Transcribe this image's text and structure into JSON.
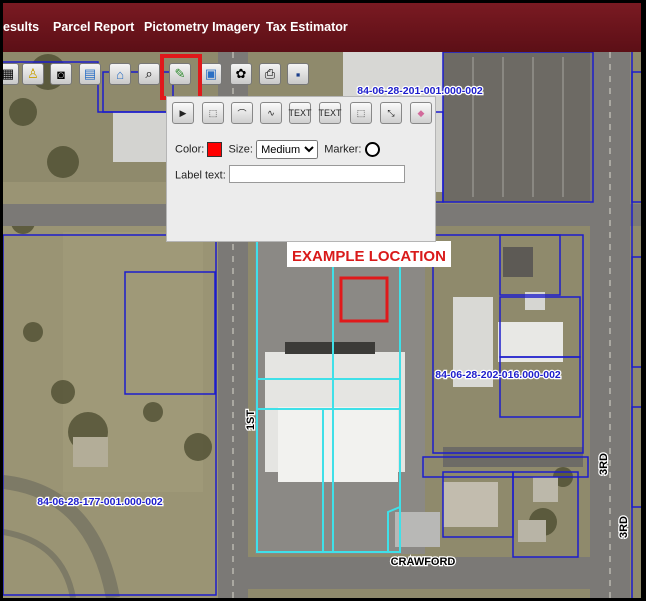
{
  "nav": {
    "items": [
      "esults",
      "Parcel Report",
      "Pictometry Imagery",
      "Tax Estimator"
    ]
  },
  "map": {
    "parcel_labels": [
      "84-06-28-201-001.000-002",
      "84-06-28-202-016.000-002",
      "84-06-28-177-001.000-002"
    ],
    "street_labels": [
      "1ST",
      "3RD",
      "3RD",
      "CRAWFORD"
    ],
    "annotation": "EXAMPLE LOCATION",
    "annotation_color": "#d91a1a",
    "parcel_line_color": "#1d1dcc",
    "selected_parcel_color": "#3fe0e8"
  },
  "toolbar": {
    "icons": [
      "layers-icon",
      "person-icon",
      "camera-icon",
      "legend-icon",
      "parcel-icon",
      "search-icon",
      "draw-pen-icon",
      "measure-icon",
      "identify-icon",
      "print-icon",
      "save-icon"
    ]
  },
  "draw_panel": {
    "tools": [
      "select",
      "point",
      "polyline",
      "curve",
      "TEXT",
      "TEXT",
      "area",
      "edit",
      "erase"
    ],
    "color_label": "Color:",
    "color_value": "#ff0000",
    "size_label": "Size:",
    "size_options": [
      "Medium"
    ],
    "marker_label": "Marker:",
    "label_text_label": "Label text:",
    "label_text_value": ""
  }
}
